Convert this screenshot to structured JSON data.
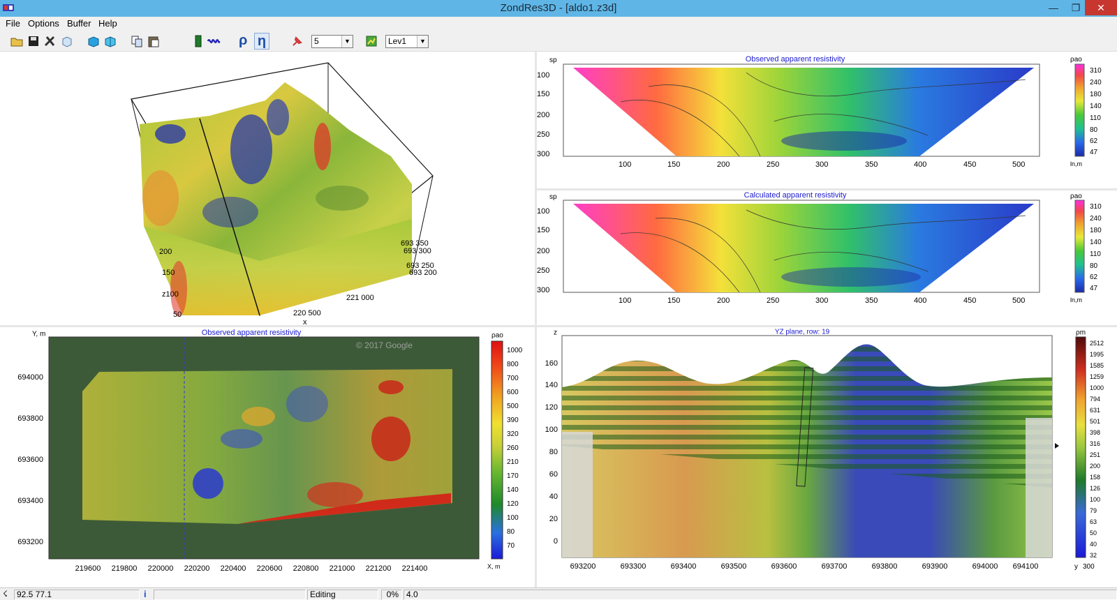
{
  "window": {
    "title": "ZondRes3D - [aldo1.z3d]"
  },
  "menu": [
    "File",
    "Options",
    "Buffer",
    "Help"
  ],
  "toolbar": {
    "icons": [
      "open-icon",
      "save-icon",
      "tools-icon",
      "cube-icon",
      "cube-view-icon",
      "cube-slice-icon",
      "copy-icon",
      "paste-icon",
      "battery-icon",
      "spring-icon",
      "rho-icon",
      "eta-icon",
      "pin-icon",
      "map-icon"
    ],
    "rho_label": "ρ",
    "eta_label": "η",
    "level_value": "5",
    "layer_value": "Lev1"
  },
  "view3d": {
    "axis_labels": [
      "200",
      "150",
      "z100",
      "50",
      "693 350",
      "693 300",
      "693 250",
      "693 200",
      "221 000",
      "220 500",
      "x"
    ]
  },
  "observed_section": {
    "title": "Observed apparent resistivity",
    "ylabel": "sp",
    "xunit": "ln,m",
    "legend_title": "ρao",
    "legend": [
      "310",
      "240",
      "180",
      "140",
      "110",
      "80",
      "62",
      "47"
    ],
    "yticks": [
      "100",
      "150",
      "200",
      "250",
      "300"
    ],
    "xticks": [
      "100",
      "150",
      "200",
      "250",
      "300",
      "350",
      "400",
      "450",
      "500"
    ]
  },
  "calculated_section": {
    "title": "Calculated apparent resistivity",
    "ylabel": "sp",
    "xunit": "ln,m",
    "legend_title": "ρao",
    "legend": [
      "310",
      "240",
      "180",
      "140",
      "110",
      "80",
      "62",
      "47"
    ],
    "yticks": [
      "100",
      "150",
      "200",
      "250",
      "300"
    ],
    "xticks": [
      "100",
      "150",
      "200",
      "250",
      "300",
      "350",
      "400",
      "450",
      "500"
    ]
  },
  "map_view": {
    "title": "Observed apparent resistivity",
    "ylabel": "Y, m",
    "xunit": "X, m",
    "watermark": "© 2017 Google",
    "legend_title": "ρao",
    "legend": [
      "1000",
      "800",
      "700",
      "600",
      "500",
      "390",
      "320",
      "260",
      "210",
      "170",
      "140",
      "120",
      "100",
      "80",
      "70"
    ],
    "yticks": [
      "694000",
      "693800",
      "693600",
      "693400",
      "693200"
    ],
    "xticks": [
      "219600",
      "219800",
      "220000",
      "220200",
      "220400",
      "220600",
      "220800",
      "221000",
      "221200",
      "221400"
    ]
  },
  "yz_plane": {
    "title": "YZ plane, row: 19",
    "zlabel": "z",
    "yunit": "y",
    "legend_title": "ρm",
    "legend": [
      "2512",
      "1995",
      "1585",
      "1259",
      "1000",
      "794",
      "631",
      "501",
      "398",
      "316",
      "251",
      "200",
      "158",
      "126",
      "100",
      "79",
      "63",
      "50",
      "40",
      "32"
    ],
    "legend_extra": "300",
    "zticks": [
      "160",
      "140",
      "120",
      "100",
      "80",
      "60",
      "40",
      "20",
      "0"
    ],
    "yticks": [
      "693200",
      "693300",
      "693400",
      "693500",
      "693600",
      "693700",
      "693800",
      "693900",
      "694000",
      "694100"
    ]
  },
  "statusbar": {
    "coords": "92.5 77.1",
    "mode": "Editing",
    "progress": "0%",
    "value": "4.0"
  },
  "colors": {
    "titlebar": "#5fb6e6",
    "close_button": "#c7372f",
    "plot_title": "#1a1ad0"
  }
}
